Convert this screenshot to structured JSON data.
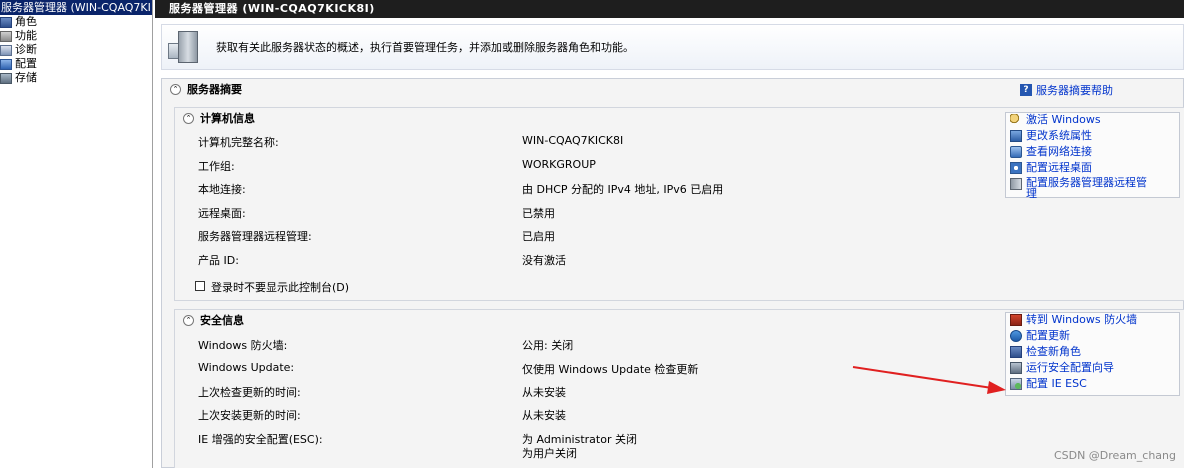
{
  "tree": {
    "root": "服务器管理器 (WIN-CQAQ7KI",
    "items": [
      {
        "label": "角色",
        "icon": "roles-icon"
      },
      {
        "label": "功能",
        "icon": "features-icon"
      },
      {
        "label": "诊断",
        "icon": "diagnostics-icon"
      },
      {
        "label": "配置",
        "icon": "configuration-icon"
      },
      {
        "label": "存储",
        "icon": "storage-icon"
      }
    ]
  },
  "main": {
    "title": "服务器管理器 (WIN-CQAQ7KICK8I)",
    "intro": "获取有关此服务器状态的概述，执行首要管理任务，并添加或删除服务器角色和功能。"
  },
  "summary": {
    "title": "服务器摘要",
    "help": "服务器摘要帮助",
    "computer": {
      "title": "计算机信息",
      "rows": [
        {
          "key": "计算机完整名称:",
          "value": "WIN-CQAQ7KICK8I"
        },
        {
          "key": "工作组:",
          "value": "WORKGROUP"
        },
        {
          "key": "本地连接:",
          "value": "由 DHCP 分配的 IPv4 地址, IPv6 已启用"
        },
        {
          "key": "远程桌面:",
          "value": "已禁用"
        },
        {
          "key": "服务器管理器远程管理:",
          "value": "已启用"
        },
        {
          "key": "产品 ID:",
          "value": "没有激活"
        }
      ],
      "checkbox": "登录时不要显示此控制台(D)",
      "tasks": [
        "激活 Windows",
        "更改系统属性",
        "查看网络连接",
        "配置远程桌面",
        "配置服务器管理器远程管",
        "理"
      ]
    },
    "security": {
      "title": "安全信息",
      "rows": [
        {
          "key": "Windows 防火墙:",
          "value": "公用: 关闭"
        },
        {
          "key": "Windows Update:",
          "value": "仅使用 Windows Update 检查更新"
        },
        {
          "key": "上次检查更新的时间:",
          "value": "从未安装"
        },
        {
          "key": "上次安装更新的时间:",
          "value": "从未安装"
        },
        {
          "key": "IE 增强的安全配置(ESC):",
          "value": "为 Administrator 关闭",
          "value2": "为用户关闭"
        }
      ],
      "tasks": [
        "转到 Windows 防火墙",
        "配置更新",
        "检查新角色",
        "运行安全配置向导",
        "配置 IE ESC"
      ]
    }
  },
  "watermark": "CSDN @Dream_chang",
  "colors": {
    "link": "#0033cc",
    "arrow": "#e02020",
    "tree_selected": "#0a246a"
  }
}
